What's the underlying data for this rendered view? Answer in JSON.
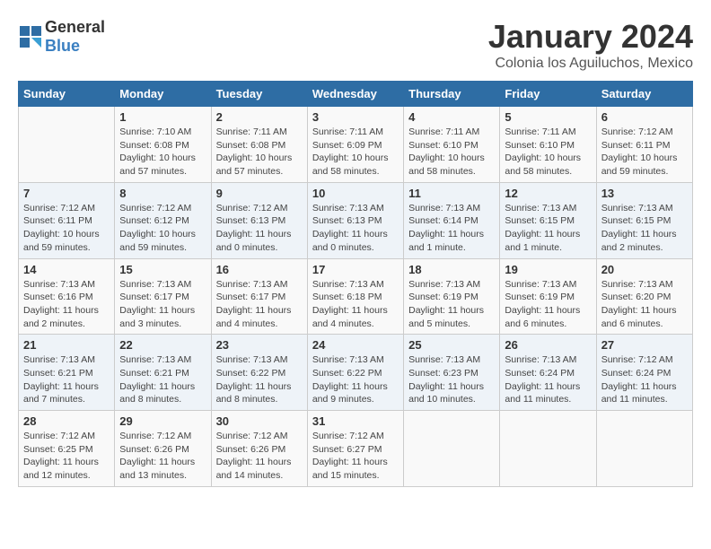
{
  "header": {
    "logo_general": "General",
    "logo_blue": "Blue",
    "month_title": "January 2024",
    "subtitle": "Colonia los Aguiluchos, Mexico"
  },
  "days_of_week": [
    "Sunday",
    "Monday",
    "Tuesday",
    "Wednesday",
    "Thursday",
    "Friday",
    "Saturday"
  ],
  "weeks": [
    [
      {
        "day": "",
        "detail": ""
      },
      {
        "day": "1",
        "detail": "Sunrise: 7:10 AM\nSunset: 6:08 PM\nDaylight: 10 hours and 57 minutes."
      },
      {
        "day": "2",
        "detail": "Sunrise: 7:11 AM\nSunset: 6:08 PM\nDaylight: 10 hours and 57 minutes."
      },
      {
        "day": "3",
        "detail": "Sunrise: 7:11 AM\nSunset: 6:09 PM\nDaylight: 10 hours and 58 minutes."
      },
      {
        "day": "4",
        "detail": "Sunrise: 7:11 AM\nSunset: 6:10 PM\nDaylight: 10 hours and 58 minutes."
      },
      {
        "day": "5",
        "detail": "Sunrise: 7:11 AM\nSunset: 6:10 PM\nDaylight: 10 hours and 58 minutes."
      },
      {
        "day": "6",
        "detail": "Sunrise: 7:12 AM\nSunset: 6:11 PM\nDaylight: 10 hours and 59 minutes."
      }
    ],
    [
      {
        "day": "7",
        "detail": "Sunrise: 7:12 AM\nSunset: 6:11 PM\nDaylight: 10 hours and 59 minutes."
      },
      {
        "day": "8",
        "detail": "Sunrise: 7:12 AM\nSunset: 6:12 PM\nDaylight: 10 hours and 59 minutes."
      },
      {
        "day": "9",
        "detail": "Sunrise: 7:12 AM\nSunset: 6:13 PM\nDaylight: 11 hours and 0 minutes."
      },
      {
        "day": "10",
        "detail": "Sunrise: 7:13 AM\nSunset: 6:13 PM\nDaylight: 11 hours and 0 minutes."
      },
      {
        "day": "11",
        "detail": "Sunrise: 7:13 AM\nSunset: 6:14 PM\nDaylight: 11 hours and 1 minute."
      },
      {
        "day": "12",
        "detail": "Sunrise: 7:13 AM\nSunset: 6:15 PM\nDaylight: 11 hours and 1 minute."
      },
      {
        "day": "13",
        "detail": "Sunrise: 7:13 AM\nSunset: 6:15 PM\nDaylight: 11 hours and 2 minutes."
      }
    ],
    [
      {
        "day": "14",
        "detail": "Sunrise: 7:13 AM\nSunset: 6:16 PM\nDaylight: 11 hours and 2 minutes."
      },
      {
        "day": "15",
        "detail": "Sunrise: 7:13 AM\nSunset: 6:17 PM\nDaylight: 11 hours and 3 minutes."
      },
      {
        "day": "16",
        "detail": "Sunrise: 7:13 AM\nSunset: 6:17 PM\nDaylight: 11 hours and 4 minutes."
      },
      {
        "day": "17",
        "detail": "Sunrise: 7:13 AM\nSunset: 6:18 PM\nDaylight: 11 hours and 4 minutes."
      },
      {
        "day": "18",
        "detail": "Sunrise: 7:13 AM\nSunset: 6:19 PM\nDaylight: 11 hours and 5 minutes."
      },
      {
        "day": "19",
        "detail": "Sunrise: 7:13 AM\nSunset: 6:19 PM\nDaylight: 11 hours and 6 minutes."
      },
      {
        "day": "20",
        "detail": "Sunrise: 7:13 AM\nSunset: 6:20 PM\nDaylight: 11 hours and 6 minutes."
      }
    ],
    [
      {
        "day": "21",
        "detail": "Sunrise: 7:13 AM\nSunset: 6:21 PM\nDaylight: 11 hours and 7 minutes."
      },
      {
        "day": "22",
        "detail": "Sunrise: 7:13 AM\nSunset: 6:21 PM\nDaylight: 11 hours and 8 minutes."
      },
      {
        "day": "23",
        "detail": "Sunrise: 7:13 AM\nSunset: 6:22 PM\nDaylight: 11 hours and 8 minutes."
      },
      {
        "day": "24",
        "detail": "Sunrise: 7:13 AM\nSunset: 6:22 PM\nDaylight: 11 hours and 9 minutes."
      },
      {
        "day": "25",
        "detail": "Sunrise: 7:13 AM\nSunset: 6:23 PM\nDaylight: 11 hours and 10 minutes."
      },
      {
        "day": "26",
        "detail": "Sunrise: 7:13 AM\nSunset: 6:24 PM\nDaylight: 11 hours and 11 minutes."
      },
      {
        "day": "27",
        "detail": "Sunrise: 7:12 AM\nSunset: 6:24 PM\nDaylight: 11 hours and 11 minutes."
      }
    ],
    [
      {
        "day": "28",
        "detail": "Sunrise: 7:12 AM\nSunset: 6:25 PM\nDaylight: 11 hours and 12 minutes."
      },
      {
        "day": "29",
        "detail": "Sunrise: 7:12 AM\nSunset: 6:26 PM\nDaylight: 11 hours and 13 minutes."
      },
      {
        "day": "30",
        "detail": "Sunrise: 7:12 AM\nSunset: 6:26 PM\nDaylight: 11 hours and 14 minutes."
      },
      {
        "day": "31",
        "detail": "Sunrise: 7:12 AM\nSunset: 6:27 PM\nDaylight: 11 hours and 15 minutes."
      },
      {
        "day": "",
        "detail": ""
      },
      {
        "day": "",
        "detail": ""
      },
      {
        "day": "",
        "detail": ""
      }
    ]
  ]
}
